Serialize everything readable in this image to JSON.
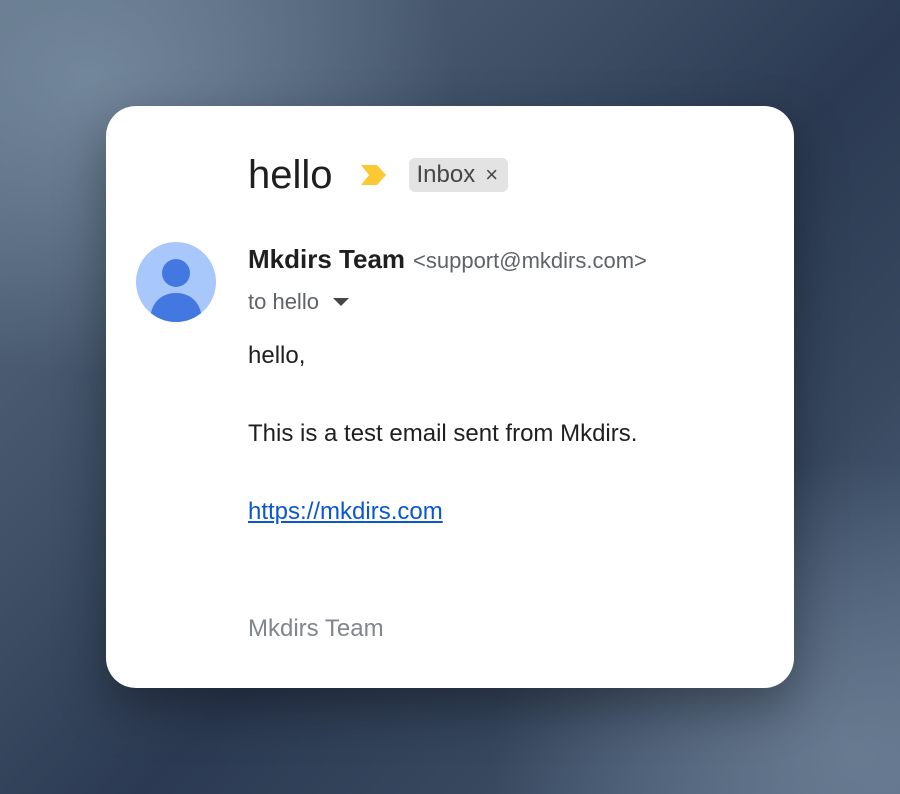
{
  "email": {
    "subject": "hello",
    "label": "Inbox",
    "label_close": "×",
    "sender_name": "Mkdirs Team",
    "sender_email": "<support@mkdirs.com>",
    "recipient_line": "to hello",
    "body_greeting": "hello,",
    "body_text": "This is a test email sent from Mkdirs.",
    "body_link": "https://mkdirs.com",
    "signature": "Mkdirs Team"
  },
  "colors": {
    "importance_marker": "#fcc934",
    "avatar_bg": "#a8c7fa",
    "avatar_fg": "#4378e0",
    "link": "#0b57d0"
  },
  "icons": {
    "importance": "importance-marker-icon",
    "avatar": "person-icon",
    "dropdown": "caret-down-icon",
    "close": "close-icon"
  }
}
